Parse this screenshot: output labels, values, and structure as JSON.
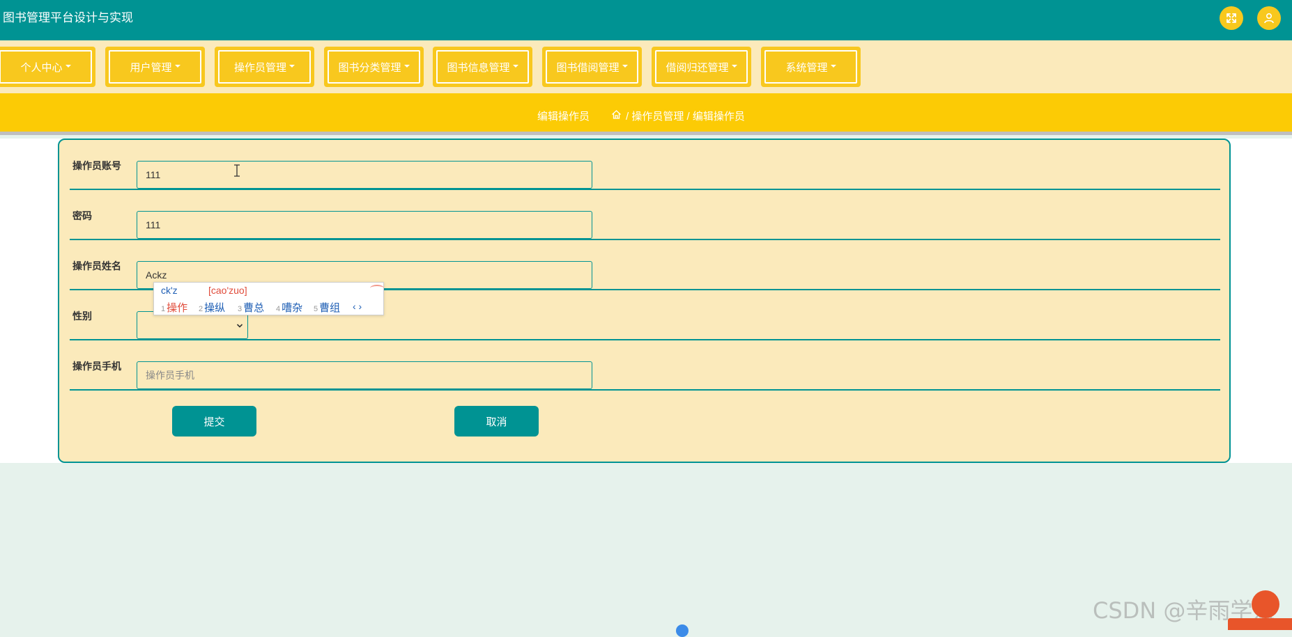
{
  "header": {
    "title": "图书管理平台设计与实现",
    "icons": [
      "expand-icon",
      "user-icon"
    ],
    "accent": "#009393",
    "yellow": "#f8c81e"
  },
  "nav": {
    "items": [
      {
        "label": "个人中心"
      },
      {
        "label": "用户管理"
      },
      {
        "label": "操作员管理"
      },
      {
        "label": "图书分类管理"
      },
      {
        "label": "图书信息管理"
      },
      {
        "label": "图书借阅管理"
      },
      {
        "label": "借阅归还管理"
      },
      {
        "label": "系统管理"
      }
    ]
  },
  "breadcrumb": {
    "page_title": "编辑操作员",
    "path": "/ 操作员管理 / 编辑操作员"
  },
  "form": {
    "fields": [
      {
        "label": "操作员账号",
        "value": "111",
        "placeholder": ""
      },
      {
        "label": "密码",
        "value": "111",
        "placeholder": ""
      },
      {
        "label": "操作员姓名",
        "value": "Ackz",
        "placeholder": ""
      },
      {
        "label": "性别",
        "value": ""
      },
      {
        "label": "操作员手机",
        "value": "",
        "placeholder": "操作员手机"
      }
    ],
    "submit_label": "提交",
    "cancel_label": "取消"
  },
  "ime": {
    "pinyin": "ck'z",
    "hint": "[cao'zuo]",
    "candidates": [
      {
        "num": "1",
        "text": "操作"
      },
      {
        "num": "2",
        "text": "操纵"
      },
      {
        "num": "3",
        "text": "曹总"
      },
      {
        "num": "4",
        "text": "嘈杂"
      },
      {
        "num": "5",
        "text": "曹组"
      }
    ],
    "arrows": "‹ ›"
  },
  "watermark": "CSDN @辛雨学姐"
}
